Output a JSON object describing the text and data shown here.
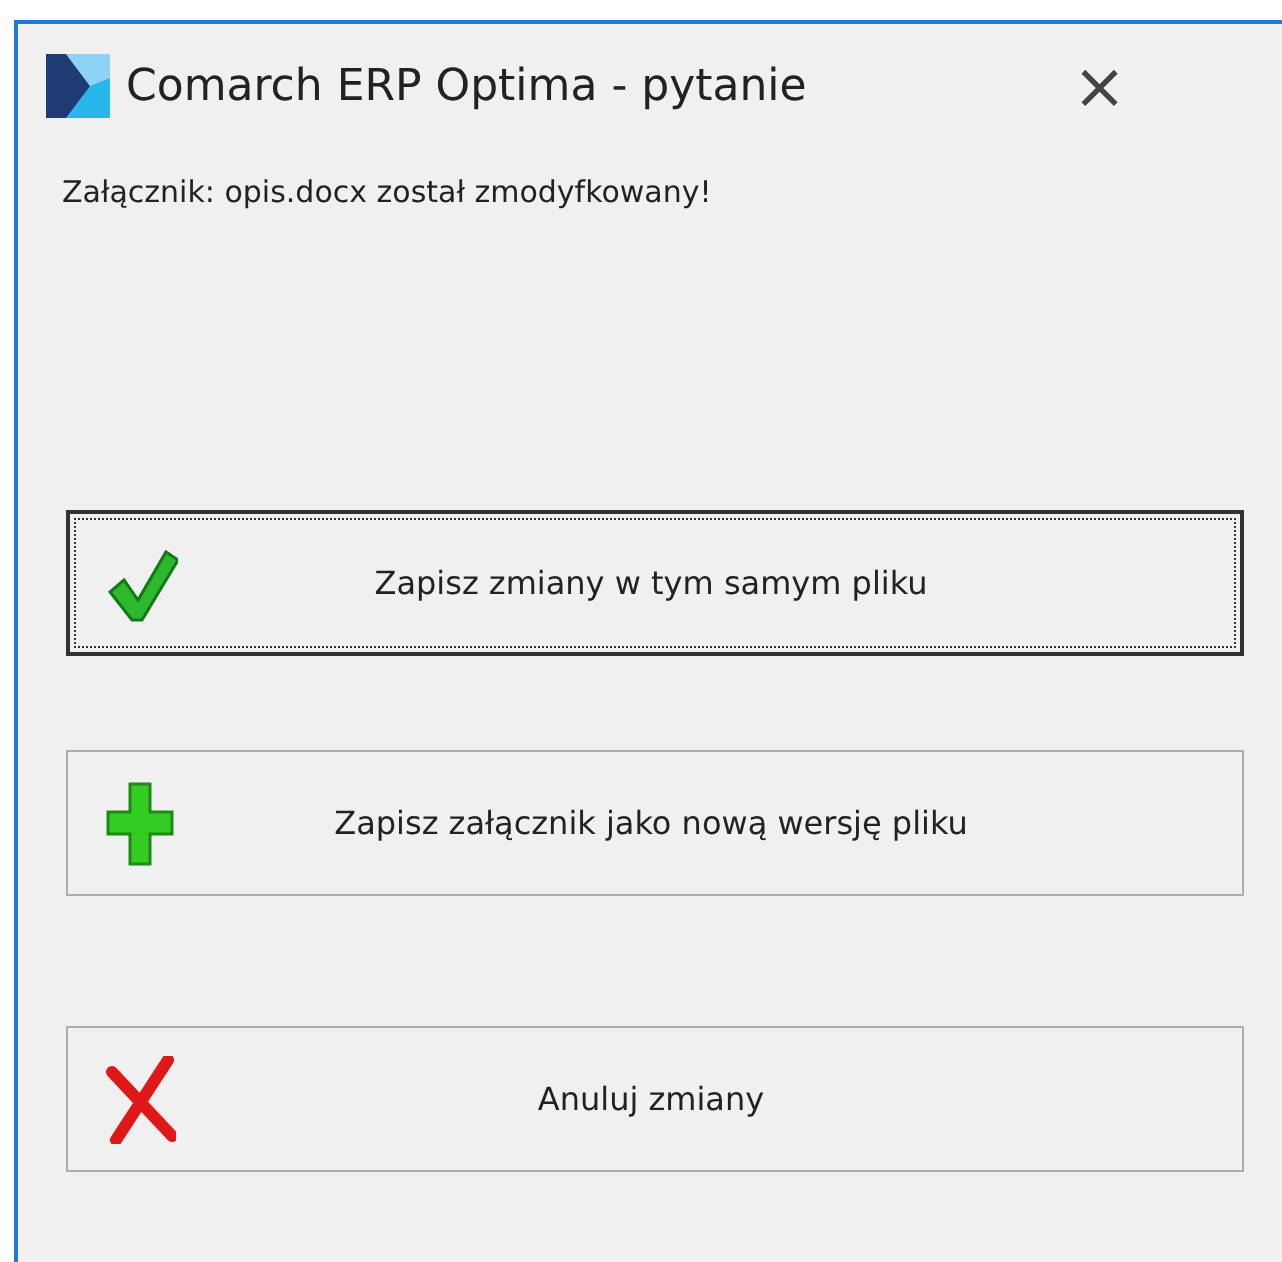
{
  "window": {
    "title": "Comarch ERP Optima - pytanie",
    "close": "×"
  },
  "message": "Załącznik: opis.docx został zmodyfkowany!",
  "buttons": [
    {
      "kind": "check",
      "label": "Zapisz zmiany w tym samym pliku",
      "focused": true
    },
    {
      "kind": "plus",
      "label": "Zapisz załącznik jako nową wersję pliku",
      "focused": false
    },
    {
      "kind": "cross",
      "label": "Anuluj zmiany",
      "focused": false
    }
  ]
}
